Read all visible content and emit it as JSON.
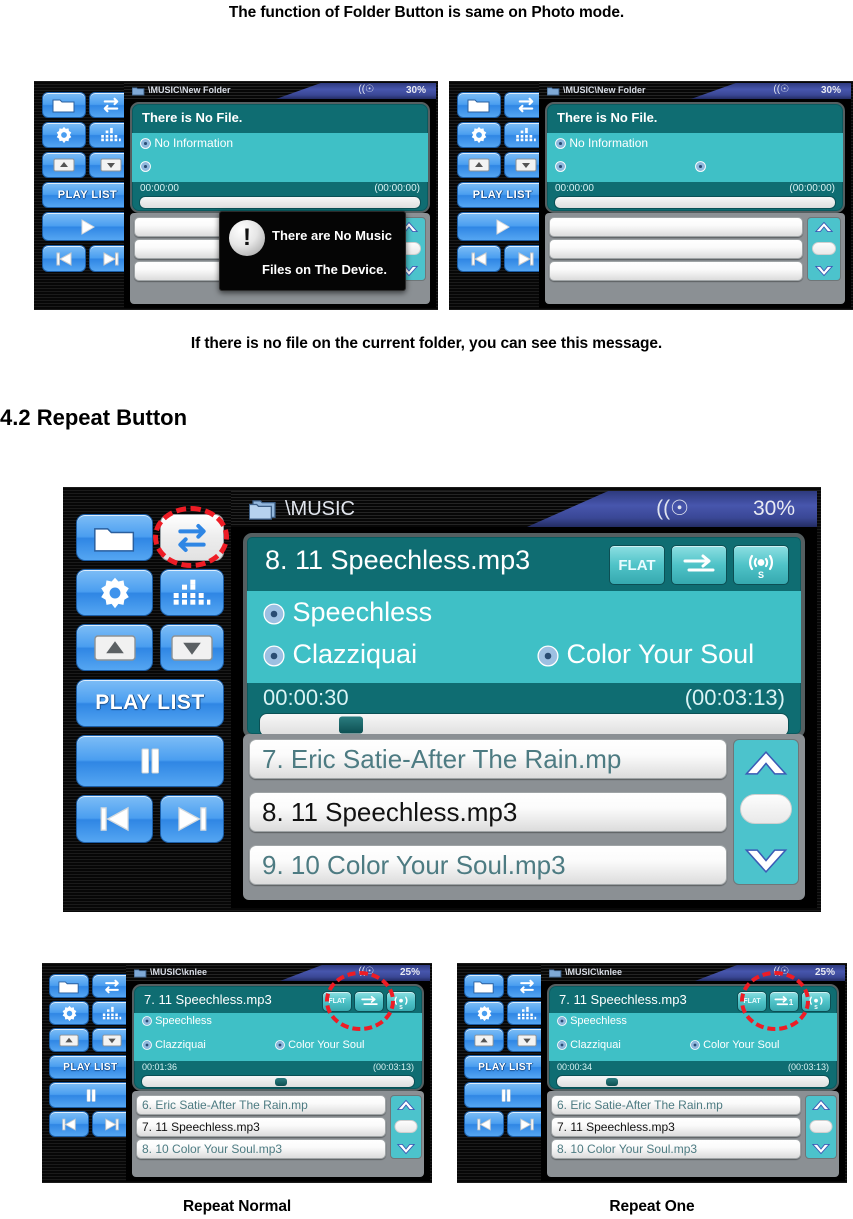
{
  "document": {
    "top_caption": "The function of Folder Button is same on Photo mode.",
    "mid_caption": "If there is no file on the current folder, you can see this message.",
    "section_heading": "4.2 Repeat Button",
    "bottom_caption_left": "Repeat Normal",
    "bottom_caption_right": "Repeat One"
  },
  "colors": {
    "accent_blue": "#4a9ef0",
    "screen_teal": "#3fc0c6",
    "panel_teal": "#0f6d72",
    "highlight_red": "#ee1c25",
    "titlebar_blue": "#4756ad"
  },
  "buttons": {
    "folder": "folder-icon",
    "repeat": "repeat-icon",
    "settings": "gear-icon",
    "equalizer": "equalizer-icon",
    "up": "up-arrow-icon",
    "down": "down-arrow-icon",
    "play_list": "PLAY LIST",
    "play": "play-icon",
    "pause": "pause-icon",
    "prev": "previous-track-icon",
    "next": "next-track-icon"
  },
  "screens": [
    {
      "id": "no-file-with-dialog",
      "path": "\\MUSIC\\New Folder",
      "battery": "30%",
      "title": "There is No File.",
      "artist": "No Information",
      "album": "",
      "extra": "",
      "elapsed": "00:00:00",
      "total": "(00:00:00)",
      "progress_pct": 0,
      "eq_label": "",
      "playlist": [
        "",
        "",
        ""
      ],
      "selected_index": -1,
      "dialog": {
        "icon": "!",
        "line1": "There are No Music",
        "line2": "Files on The Device."
      }
    },
    {
      "id": "no-file-plain",
      "path": "\\MUSIC\\New Folder",
      "battery": "30%",
      "title": "There is No File.",
      "artist": "No Information",
      "album": "",
      "extra": "",
      "elapsed": "00:00:00",
      "total": "(00:00:00)",
      "progress_pct": 0,
      "eq_label": "",
      "playlist": [
        "",
        "",
        ""
      ],
      "selected_index": -1,
      "dialog": null
    }
  ],
  "main_screen": {
    "id": "repeat-button-main",
    "path": "\\MUSIC",
    "battery": "30%",
    "title": "8. 11 Speechless.mp3",
    "artist": "Speechless",
    "album": "Clazziquai",
    "extra": "Color Your Soul",
    "elapsed": "00:00:30",
    "total": "(00:03:13)",
    "progress_pct": 15,
    "eq_label": "FLAT",
    "repeat_mode_icon": "repeat-normal-icon",
    "sound_icon": "srs-sound-icon",
    "playlist": [
      "7. Eric Satie-After The Rain.mp",
      "8. 11 Speechless.mp3",
      "9. 10 Color Your Soul.mp3"
    ],
    "selected_index": 1,
    "transport": "pause-icon"
  },
  "small_screens": [
    {
      "id": "repeat-normal",
      "path": "\\MUSIC\\knlee",
      "battery": "25%",
      "title": "7. 11 Speechless.mp3",
      "artist": "Speechless",
      "album": "Clazziquai",
      "extra": "Color Your Soul",
      "elapsed": "00:01:36",
      "total": "(00:03:13)",
      "progress_pct": 49,
      "eq_label": "FLAT",
      "repeat_mode_icon": "repeat-normal-icon",
      "playlist": [
        "6. Eric Satie-After The Rain.mp",
        "7. 11 Speechless.mp3",
        "8. 10 Color Your Soul.mp3"
      ],
      "selected_index": 1
    },
    {
      "id": "repeat-one",
      "path": "\\MUSIC\\knlee",
      "battery": "25%",
      "title": "7. 11 Speechless.mp3",
      "artist": "Speechless",
      "album": "Clazziquai",
      "extra": "Color Your Soul",
      "elapsed": "00:00:34",
      "total": "(00:03:13)",
      "progress_pct": 18,
      "eq_label": "FLAT",
      "repeat_mode_icon": "repeat-one-icon",
      "playlist": [
        "6. Eric Satie-After The Rain.mp",
        "7. 11 Speechless.mp3",
        "8. 10 Color Your Soul.mp3"
      ],
      "selected_index": 1
    }
  ]
}
